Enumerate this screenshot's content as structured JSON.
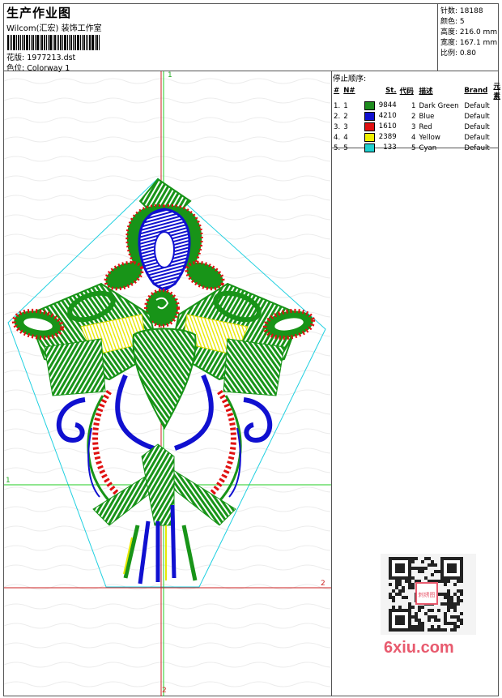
{
  "header": {
    "title": "生产作业图",
    "company": "Wilcom(汇宏) 装饰工作室",
    "design_label": "花版:",
    "design_file": "1977213.dst",
    "colorway_label": "色位:",
    "colorway": "Colorway 1"
  },
  "stats": {
    "stitches_label": "针数:",
    "stitches": "18188",
    "colors_label": "颜色:",
    "colors": "5",
    "height_label": "高度:",
    "height": "216.0 mm",
    "width_label": "宽度:",
    "width": "167.1 mm",
    "scale_label": "比例:",
    "scale": "0.80"
  },
  "sequence": {
    "title": "停止顺序:",
    "headers": [
      "#",
      "N#",
      "St.",
      "代码",
      "描述",
      "Brand",
      "元素"
    ],
    "rows": [
      {
        "n": "1.",
        "nn": "1",
        "color": "#1e8c1e",
        "st": "9844",
        "code": "1",
        "desc": "Dark Green",
        "brand": "Default"
      },
      {
        "n": "2.",
        "nn": "2",
        "color": "#1010d0",
        "st": "4210",
        "code": "2",
        "desc": "Blue",
        "brand": "Default"
      },
      {
        "n": "3.",
        "nn": "3",
        "color": "#e01010",
        "st": "1610",
        "code": "3",
        "desc": "Red",
        "brand": "Default"
      },
      {
        "n": "4.",
        "nn": "4",
        "color": "#f0f000",
        "st": "2389",
        "code": "4",
        "desc": "Yellow",
        "brand": "Default"
      },
      {
        "n": "5.",
        "nn": "5",
        "color": "#20d0d0",
        "st": "133",
        "code": "5",
        "desc": "Cyan",
        "brand": "Default"
      }
    ]
  },
  "axes": {
    "top": "1",
    "left": "1",
    "right": "2",
    "bottom": "2"
  },
  "watermark": "6xiu.com",
  "qr_stamp": "刺绣图"
}
